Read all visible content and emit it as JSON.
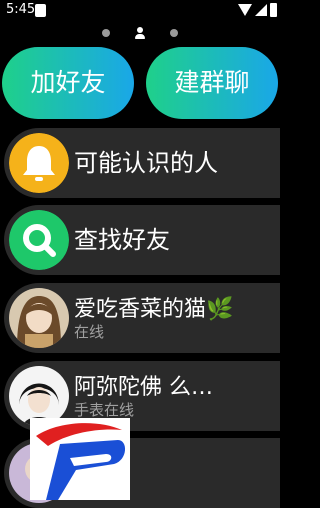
{
  "status_bar": {
    "time": "5:45"
  },
  "pager": {
    "dots": 3,
    "active_index": 1
  },
  "actions": {
    "add_friend": "加好友",
    "create_group": "建群聊"
  },
  "list": [
    {
      "title": "可能认识的人",
      "subtitle": "",
      "icon": "bell-icon",
      "icon_color": "#f5b21a"
    },
    {
      "title": "查找好友",
      "subtitle": "",
      "icon": "search-icon",
      "icon_color": "#1ec86a"
    },
    {
      "title": "爱吃香菜的猫🌿",
      "subtitle": "在线",
      "icon": "avatar"
    },
    {
      "title": "阿弥陀佛 么…",
      "subtitle": "手表在线",
      "icon": "avatar"
    }
  ],
  "colors": {
    "pill_start": "#1fd08a",
    "pill_end": "#1aa7e8",
    "row_bg": "#2a2a2a",
    "overlay_logo_red": "#e02020",
    "overlay_logo_blue": "#1a4fd6"
  }
}
